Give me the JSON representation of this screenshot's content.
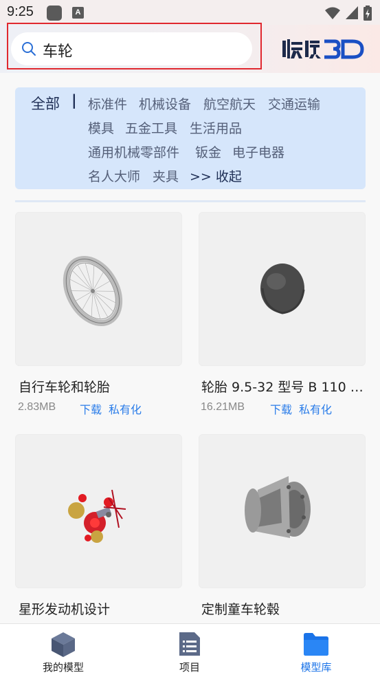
{
  "status_bar": {
    "time": "9:25",
    "a_icon_text": "A"
  },
  "search": {
    "query": "车轮"
  },
  "categories": {
    "all": "全部",
    "separator": "|",
    "items": [
      "标准件",
      "机械设备",
      "航空航天",
      "交通运输",
      "模具",
      "五金工具",
      "生活用品",
      "通用机械零部件",
      "钣金",
      "电子电器",
      "名人大师",
      "夹具"
    ],
    "collapse": ">> 收起"
  },
  "models": [
    {
      "title": "自行车轮和轮胎",
      "size": "2.83MB",
      "download": "下载",
      "privatize": "私有化"
    },
    {
      "title": "轮胎 9.5-32 型号 B 110 …",
      "size": "16.21MB",
      "download": "下载",
      "privatize": "私有化"
    },
    {
      "title": "星形发动机设计"
    },
    {
      "title": "定制童车轮毂"
    }
  ],
  "bottom_nav": {
    "items": [
      {
        "label": "我的模型",
        "icon": "cube-icon"
      },
      {
        "label": "项目",
        "icon": "document-list-icon"
      },
      {
        "label": "模型库",
        "icon": "folder-icon",
        "active": true
      }
    ]
  },
  "colors": {
    "accent": "#1a73e8",
    "link": "#2b7de9",
    "panel": "#d6e6fb",
    "highlight": "#e0282f"
  }
}
